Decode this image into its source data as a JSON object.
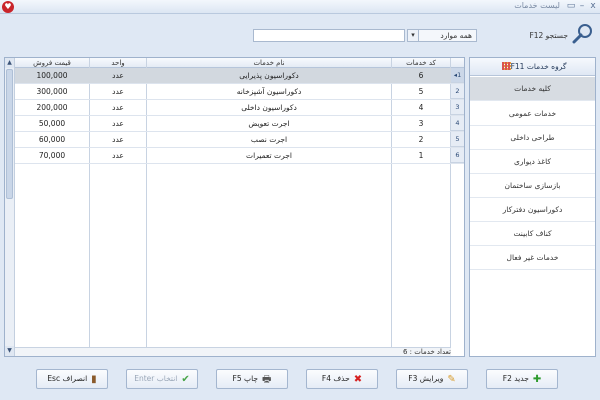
{
  "window": {
    "title": "لیست خدمات",
    "controls": {
      "close": "x",
      "minimize": "–",
      "maximize": "▭"
    }
  },
  "search": {
    "label": "جستجو F12",
    "value": "",
    "filter_selected": "همه موارد",
    "filter_arrow": "▾"
  },
  "table": {
    "headers": {
      "code": "کد خدمات",
      "name": "نام خدمات",
      "unit": "واحد",
      "price": "قیمت فروش"
    },
    "rows": [
      {
        "num": "1",
        "code": "6",
        "name": "دکوراسیون پذیرایی",
        "unit": "عدد",
        "price": "100,000"
      },
      {
        "num": "2",
        "code": "5",
        "name": "دکوراسیون آشپزخانه",
        "unit": "عدد",
        "price": "300,000"
      },
      {
        "num": "3",
        "code": "4",
        "name": "دکوراسیون داخلی",
        "unit": "عدد",
        "price": "200,000"
      },
      {
        "num": "4",
        "code": "3",
        "name": "اجرت تعویض",
        "unit": "عدد",
        "price": "50,000"
      },
      {
        "num": "5",
        "code": "2",
        "name": "اجرت نصب",
        "unit": "عدد",
        "price": "60,000"
      },
      {
        "num": "6",
        "code": "1",
        "name": "اجرت تعمیرات",
        "unit": "عدد",
        "price": "70,000"
      }
    ],
    "current_row_marker": "◂",
    "footer_count": "تعداد خدمات : 6"
  },
  "groups": {
    "title": "گروه خدمات F11",
    "items": [
      "کلیه خدمات",
      "خدمات عمومی",
      "طراحی داخلی",
      "کاغذ دیواری",
      "بازسازی ساختمان",
      "دکوراسیون دفترکار",
      "کناف کابینت",
      "خدمات غیر فعال"
    ]
  },
  "buttons": {
    "new": "جدید F2",
    "edit": "ویرایش F3",
    "delete": "حذف F4",
    "print": "چاپ F5",
    "select": "انتخاب Enter",
    "cancel": "انصراف Esc"
  }
}
